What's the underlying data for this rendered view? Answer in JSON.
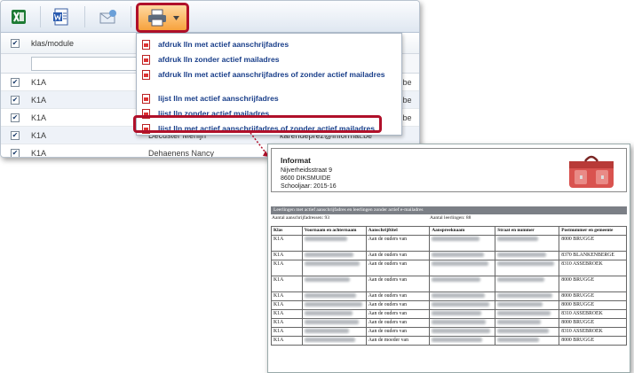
{
  "grid": {
    "header": {
      "column_label": "klas/module"
    },
    "rows": [
      {
        "klas": "K1A",
        "name": "",
        "mail": "",
        "tail": ".be"
      },
      {
        "klas": "K1A",
        "name": "",
        "mail": "",
        "tail": ".be"
      },
      {
        "klas": "K1A",
        "name": "",
        "mail": "",
        "tail": ".be"
      },
      {
        "klas": "K1A",
        "name": "Decuster Merlijn",
        "mail": "karendeprez@informat.be",
        "tail": ""
      },
      {
        "klas": "K1A",
        "name": "Dehaenens Nancy",
        "mail": "",
        "tail": ""
      }
    ]
  },
  "toolbar": {
    "icons": [
      "excel-icon",
      "word-icon",
      "email-icon",
      "printer-icon"
    ]
  },
  "menu": {
    "items": [
      {
        "label": "afdruk lln met actief aanschrijfadres"
      },
      {
        "label": "afdruk lln zonder actief mailadres"
      },
      {
        "label": "afdruk lln met actief aanschrijfadres of zonder actief mailadres"
      },
      {
        "label": "lijst lln met actief aanschrijfadres"
      },
      {
        "label": "lijst lln zonder actief mailadres"
      },
      {
        "label": "lijst lln met actief aanschrijfadres of zonder actief mailadres"
      }
    ],
    "highlighted_index": 5
  },
  "report": {
    "brand": "Informat",
    "address_line1": "Nijverheidsstraat 9",
    "address_line2": "8600 DIKSMUIDE",
    "schoolyear": "Schooljaar: 2015-16",
    "band_title": "Leerlingen met actief aanschrijfadres en leerlingen zonder actief e-mailadres",
    "count_addresses": "Aantal aanschrijfadressen: 93",
    "count_students": "Aantal leerlingen: 88",
    "columns": [
      "Klas",
      "Voornaam en achternaam",
      "Aanschrijftitel",
      "Aanspreeknaam",
      "Straat en nummer",
      "Postnummer en gemeente"
    ],
    "rows": [
      {
        "klas": "K1A",
        "titel": "Aan de ouders van",
        "post": "8000 BRUGGE"
      },
      {
        "klas": "K1A",
        "titel": "Aan de ouders van",
        "post": "8370 BLANKENBERGE"
      },
      {
        "klas": "K1A",
        "titel": "Aan de ouders van",
        "post": "8310 ASSEBROEK"
      },
      {
        "klas": "K1A",
        "titel": "Aan de ouders van",
        "post": "8000 BRUGGE"
      },
      {
        "klas": "K1A",
        "titel": "Aan de ouders van",
        "post": "8000 BRUGGE"
      },
      {
        "klas": "K1A",
        "titel": "Aan de ouders van",
        "post": "8000 BRUGGE"
      },
      {
        "klas": "K1A",
        "titel": "Aan de ouders van",
        "post": "8310 ASSEBROEK"
      },
      {
        "klas": "K1A",
        "titel": "Aan de ouders van",
        "post": "8000 BRUGGE"
      },
      {
        "klas": "K1A",
        "titel": "Aan de ouders van",
        "post": "8310 ASSEBROEK"
      },
      {
        "klas": "K1A",
        "titel": "Aan de moeder van",
        "post": "8000 BRUGGE"
      }
    ]
  },
  "colors": {
    "highlight": "#b0102a",
    "menu_text": "#1a3f8a",
    "band": "#7b7f86"
  }
}
